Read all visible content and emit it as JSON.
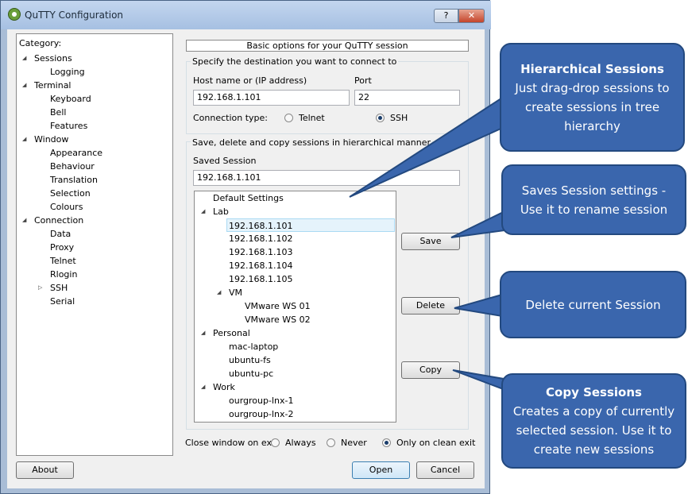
{
  "window": {
    "title": "QuTTY Configuration",
    "help_label": "?",
    "close_label": "✕"
  },
  "category": {
    "label": "Category:",
    "items": [
      {
        "label": "Sessions",
        "expander": "◢"
      },
      {
        "label": "Logging"
      },
      {
        "label": "Terminal",
        "expander": "◢"
      },
      {
        "label": "Keyboard"
      },
      {
        "label": "Bell"
      },
      {
        "label": "Features"
      },
      {
        "label": "Window",
        "expander": "◢"
      },
      {
        "label": "Appearance"
      },
      {
        "label": "Behaviour"
      },
      {
        "label": "Translation"
      },
      {
        "label": "Selection"
      },
      {
        "label": "Colours"
      },
      {
        "label": "Connection",
        "expander": "◢"
      },
      {
        "label": "Data"
      },
      {
        "label": "Proxy"
      },
      {
        "label": "Telnet"
      },
      {
        "label": "Rlogin"
      },
      {
        "label": "SSH",
        "expander": "▷"
      },
      {
        "label": "Serial"
      }
    ]
  },
  "main": {
    "header": "Basic options for your QuTTY session",
    "destination": {
      "title": "Specify the destination you want to connect to",
      "host_label": "Host name or (IP address)",
      "host_value": "192.168.1.101",
      "port_label": "Port",
      "port_value": "22",
      "conn_type_label": "Connection type:",
      "telnet_label": "Telnet",
      "ssh_label": "SSH"
    },
    "sessions": {
      "title": "Save, delete and copy sessions in hierarchical manner",
      "saved_label": "Saved Session",
      "saved_value": "192.168.1.101",
      "tree": [
        {
          "label": "Default Settings"
        },
        {
          "label": "Lab",
          "expander": "◢"
        },
        {
          "label": "192.168.1.101"
        },
        {
          "label": "192.168.1.102"
        },
        {
          "label": "192.168.1.103"
        },
        {
          "label": "192.168.1.104"
        },
        {
          "label": "192.168.1.105"
        },
        {
          "label": "VM",
          "expander": "◢"
        },
        {
          "label": "VMware WS 01"
        },
        {
          "label": "VMware WS 02"
        },
        {
          "label": "Personal",
          "expander": "◢"
        },
        {
          "label": "mac-laptop"
        },
        {
          "label": "ubuntu-fs"
        },
        {
          "label": "ubuntu-pc"
        },
        {
          "label": "Work",
          "expander": "◢"
        },
        {
          "label": "ourgroup-lnx-1"
        },
        {
          "label": "ourgroup-lnx-2"
        }
      ],
      "save_label": "Save",
      "delete_label": "Delete",
      "copy_label": "Copy"
    },
    "close_window": {
      "label": "Close window on exit",
      "always": "Always",
      "never": "Never",
      "only_clean": "Only on clean exit"
    }
  },
  "footer": {
    "about_label": "About",
    "open_label": "Open",
    "cancel_label": "Cancel"
  },
  "callouts": {
    "hierarchical": {
      "title": "Hierarchical Sessions",
      "body": "Just drag-drop sessions to create sessions in tree hierarchy"
    },
    "save": {
      "body": "Saves Session settings  - Use it to rename session"
    },
    "delete": {
      "body": "Delete current Session"
    },
    "copy": {
      "title": "Copy Sessions",
      "body": "Creates a copy of currently selected session. Use it to create new sessions"
    }
  },
  "colors": {
    "callout_fill": "#3a66ad",
    "callout_border": "#23497f",
    "selection": "#e5f3fb"
  }
}
